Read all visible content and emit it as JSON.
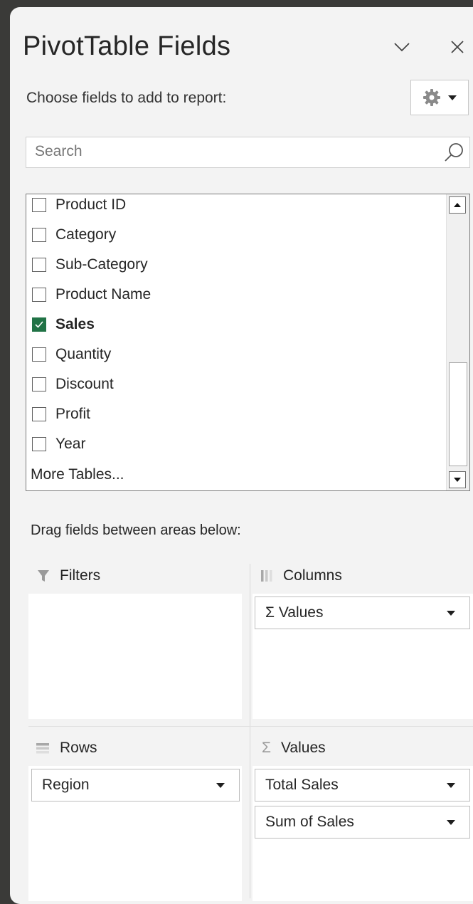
{
  "header": {
    "title": "PivotTable Fields",
    "subtitle": "Choose fields to add to report:"
  },
  "search": {
    "placeholder": "Search"
  },
  "fields": [
    {
      "label": "Product ID",
      "checked": false
    },
    {
      "label": "Category",
      "checked": false
    },
    {
      "label": "Sub-Category",
      "checked": false
    },
    {
      "label": "Product Name",
      "checked": false
    },
    {
      "label": "Sales",
      "checked": true
    },
    {
      "label": "Quantity",
      "checked": false
    },
    {
      "label": "Discount",
      "checked": false
    },
    {
      "label": "Profit",
      "checked": false
    },
    {
      "label": "Year",
      "checked": false
    }
  ],
  "more_tables": "More Tables...",
  "areas": {
    "instruction": "Drag fields between areas below:",
    "filters": {
      "label": "Filters"
    },
    "columns": {
      "label": "Columns",
      "items": [
        "Σ Values"
      ]
    },
    "rows": {
      "label": "Rows",
      "items": [
        "Region"
      ]
    },
    "values": {
      "label": "Values",
      "items": [
        "Total Sales",
        "Sum of Sales"
      ]
    }
  },
  "colors": {
    "checked": "#217346",
    "panel": "#f3f3f3",
    "frame": "#3a3a38"
  }
}
